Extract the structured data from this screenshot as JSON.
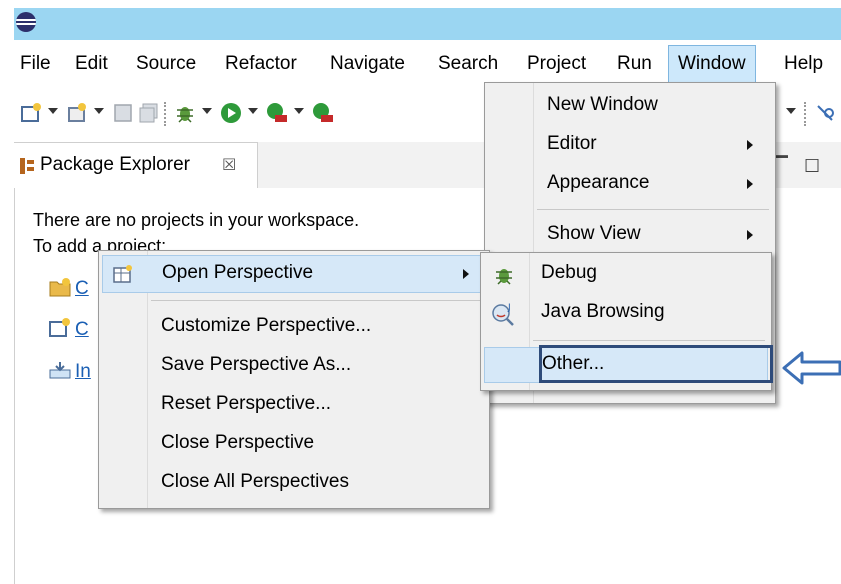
{
  "menubar": {
    "items": [
      "File",
      "Edit",
      "Source",
      "Refactor",
      "Navigate",
      "Search",
      "Project",
      "Run",
      "Window",
      "Help"
    ],
    "active": "Window"
  },
  "view": {
    "tab_label": "Package Explorer",
    "tab_close_glyph": "☒",
    "empty_line1": "There are no projects in your workspace.",
    "empty_line2": "To add a project:",
    "links": [
      "C",
      "C",
      "In"
    ]
  },
  "window_menu": {
    "items": [
      {
        "label": "New Window",
        "submenu": false
      },
      {
        "label": "Editor",
        "submenu": true
      },
      {
        "label": "Appearance",
        "submenu": true
      },
      {
        "label": "Show View",
        "submenu": true
      }
    ]
  },
  "perspective_menu": {
    "items": [
      {
        "label": "Open Perspective",
        "submenu": true,
        "icon": "open-perspective-icon"
      },
      {
        "label": "Customize Perspective...",
        "submenu": false
      },
      {
        "label": "Save Perspective As...",
        "submenu": false
      },
      {
        "label": "Reset Perspective...",
        "submenu": false
      },
      {
        "label": "Close Perspective",
        "submenu": false
      },
      {
        "label": "Close All Perspectives",
        "submenu": false
      }
    ]
  },
  "open_perspective": {
    "items": [
      {
        "label": "Debug",
        "icon": "bug-icon"
      },
      {
        "label": "Java Browsing",
        "icon": "java-browsing-icon"
      },
      {
        "label": "Other...",
        "icon": null
      }
    ]
  },
  "colors": {
    "titlebar": "#9bd6f2",
    "menu_highlight": "#cde8fb",
    "callout": "#2e4b7a",
    "arrow": "#3c6fb5"
  }
}
